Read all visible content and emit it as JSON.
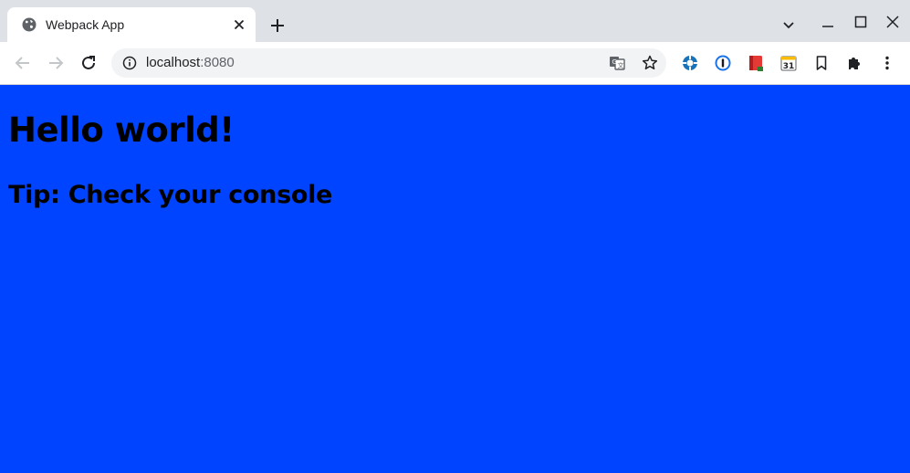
{
  "tab": {
    "title": "Webpack App",
    "favicon": "globe-icon"
  },
  "address": {
    "host": "localhost",
    "port": ":8080"
  },
  "page": {
    "heading": "Hello world!",
    "tip": "Tip: Check your console",
    "background_color": "#0044ff"
  },
  "extensions": [
    "crosshair-extension-icon",
    "password-manager-icon",
    "book-extension-icon",
    "calendar-extension-icon",
    "bookmark-icon",
    "puzzle-icon",
    "menu-icon"
  ],
  "calendar_day": "31"
}
